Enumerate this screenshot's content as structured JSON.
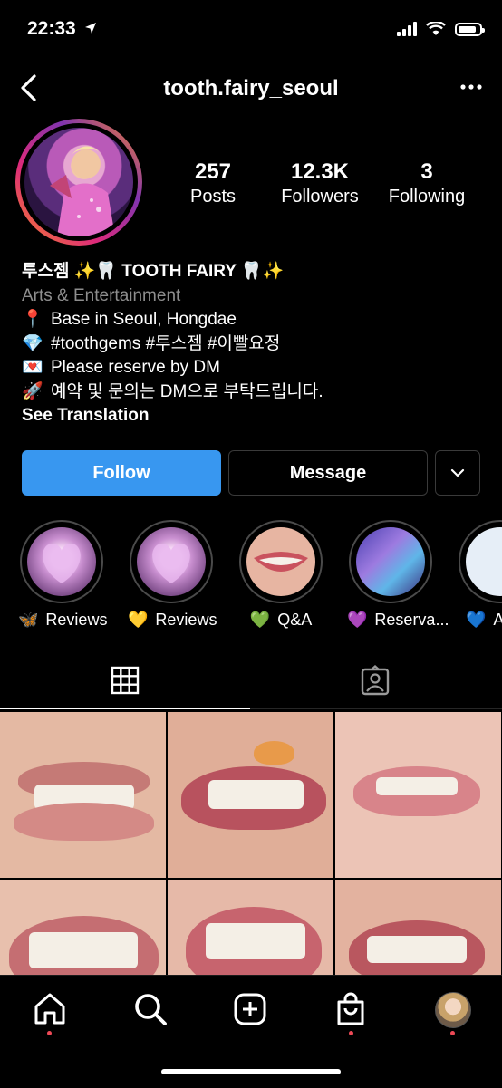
{
  "status_bar": {
    "time": "22:33"
  },
  "header": {
    "username": "tooth.fairy_seoul"
  },
  "stats": [
    {
      "value": "257",
      "label": "Posts"
    },
    {
      "value": "12.3K",
      "label": "Followers"
    },
    {
      "value": "3",
      "label": "Following"
    }
  ],
  "bio": {
    "name": "투스젬 ✨🦷 TOOTH FAIRY 🦷✨",
    "category": "Arts & Entertainment",
    "lines": [
      {
        "emoji": "📍",
        "text": "Base in Seoul, Hongdae"
      },
      {
        "emoji": "💎",
        "text": "#toothgems #투스젬 #이빨요정"
      },
      {
        "emoji": "💌",
        "text": "Please reserve by DM"
      },
      {
        "emoji": "🚀",
        "text": "예약 및 문의는 DM으로 부탁드립니다."
      }
    ],
    "see_translation": "See Translation"
  },
  "actions": {
    "follow": "Follow",
    "message": "Message"
  },
  "highlights": [
    {
      "emoji": "🦋",
      "label": "Reviews"
    },
    {
      "emoji": "💛",
      "label": "Reviews"
    },
    {
      "emoji": "💚",
      "label": "Q&A"
    },
    {
      "emoji": "💜",
      "label": "Reserva..."
    },
    {
      "emoji": "💙",
      "label": "A"
    }
  ],
  "tabs": [
    {
      "icon": "grid-icon",
      "active": true
    },
    {
      "icon": "tagged-user-icon",
      "active": false
    }
  ],
  "bottom_nav": [
    "home-icon",
    "search-icon",
    "new-post-icon",
    "shop-icon",
    "profile-avatar"
  ],
  "colors": {
    "follow_button": "#3897f0",
    "notification_dot": "#ed4956",
    "background": "#000000"
  }
}
